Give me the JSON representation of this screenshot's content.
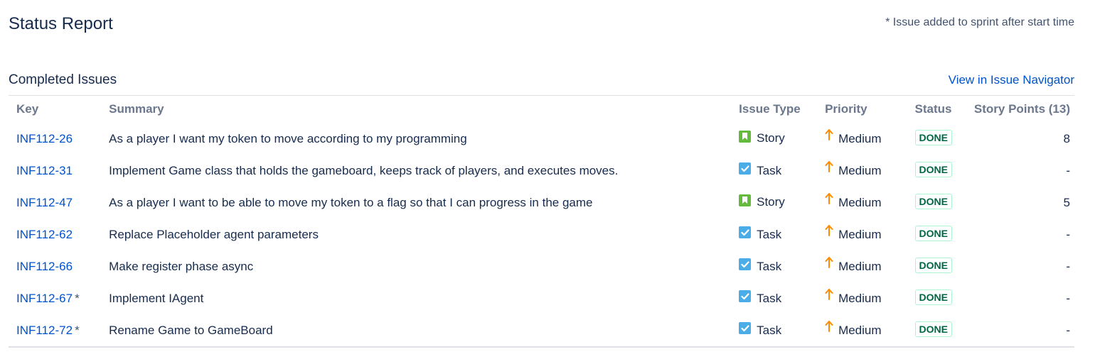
{
  "header": {
    "title": "Status Report",
    "footnote": "* Issue added to sprint after start time"
  },
  "completed": {
    "title": "Completed Issues",
    "navigator_link": "View in Issue Navigator",
    "columns": {
      "key": "Key",
      "summary": "Summary",
      "issue_type": "Issue Type",
      "priority": "Priority",
      "status": "Status",
      "points": "Story Points (13)"
    },
    "rows": [
      {
        "key": "INF112-26",
        "star": "",
        "summary": "As a player I want my token to move according to my programming",
        "type": "Story",
        "type_icon": "story-icon",
        "priority": "Medium",
        "status": "DONE",
        "points": "8"
      },
      {
        "key": "INF112-31",
        "star": "",
        "summary": "Implement Game class that holds the gameboard, keeps track of players, and executes moves.",
        "type": "Task",
        "type_icon": "task-icon",
        "priority": "Medium",
        "status": "DONE",
        "points": "-"
      },
      {
        "key": "INF112-47",
        "star": "",
        "summary": "As a player I want to be able to move my token to a flag so that I can progress in the game",
        "type": "Story",
        "type_icon": "story-icon",
        "priority": "Medium",
        "status": "DONE",
        "points": "5"
      },
      {
        "key": "INF112-62",
        "star": "",
        "summary": "Replace Placeholder agent parameters",
        "type": "Task",
        "type_icon": "task-icon",
        "priority": "Medium",
        "status": "DONE",
        "points": "-"
      },
      {
        "key": "INF112-66",
        "star": "",
        "summary": "Make register phase async",
        "type": "Task",
        "type_icon": "task-icon",
        "priority": "Medium",
        "status": "DONE",
        "points": "-"
      },
      {
        "key": "INF112-67",
        "star": "*",
        "summary": "Implement IAgent",
        "type": "Task",
        "type_icon": "task-icon",
        "priority": "Medium",
        "status": "DONE",
        "points": "-"
      },
      {
        "key": "INF112-72",
        "star": "*",
        "summary": "Rename Game to GameBoard",
        "type": "Task",
        "type_icon": "task-icon",
        "priority": "Medium",
        "status": "DONE",
        "points": "-"
      }
    ]
  },
  "colors": {
    "link": "#0052cc",
    "story": "#63ba3c",
    "task": "#4bade8",
    "priority_medium": "#ff8b00",
    "done_text": "#006644",
    "done_border": "#abf5d1"
  }
}
